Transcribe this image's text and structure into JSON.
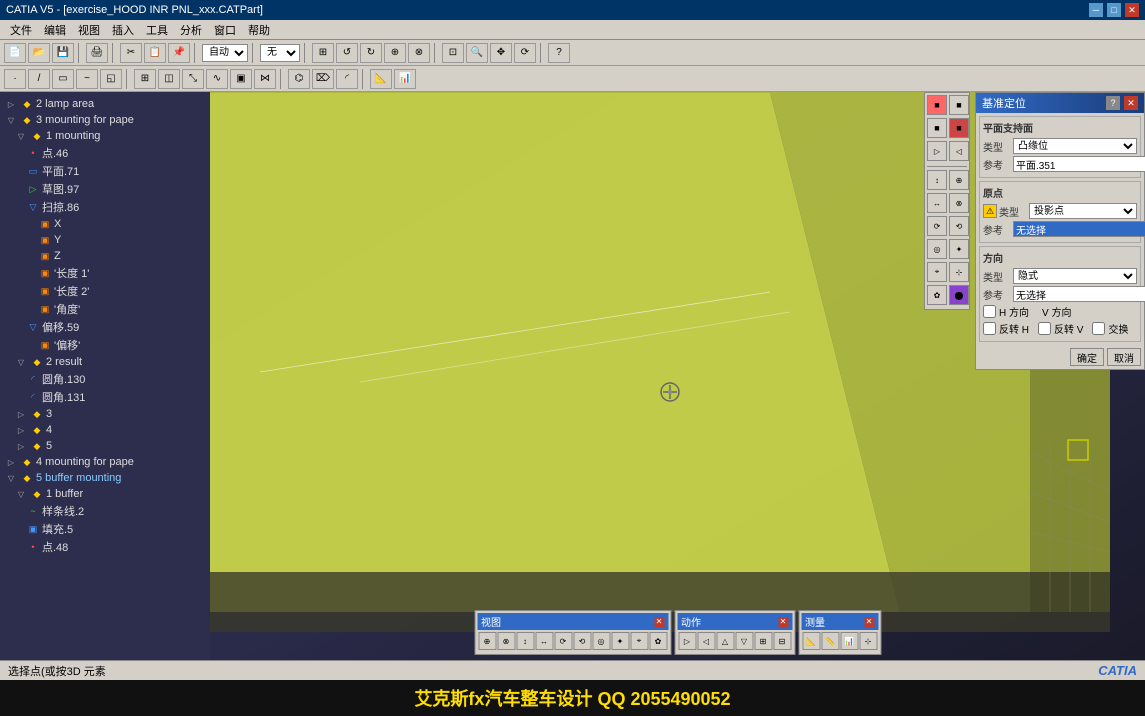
{
  "app": {
    "title": "CATIA V5 - [exercise_HOOD INR PNL_xxx.CATPart]",
    "version": "CATIA V5"
  },
  "menu": {
    "items": [
      "文件",
      "编辑",
      "视图",
      "插入",
      "工具",
      "分析",
      "窗口",
      "帮助"
    ]
  },
  "toolbar": {
    "dropdown1": "自动",
    "dropdown2": "无",
    "save_label": "保存",
    "undo_label": "撤消"
  },
  "tree": {
    "items": [
      {
        "id": "t1",
        "label": "2 lamp area",
        "level": 1,
        "icon": "branch",
        "type": "folder"
      },
      {
        "id": "t2",
        "label": "3 mounting for pape",
        "level": 1,
        "icon": "branch",
        "type": "folder"
      },
      {
        "id": "t3",
        "label": "1 mounting",
        "level": 2,
        "icon": "branch",
        "type": "folder"
      },
      {
        "id": "t4",
        "label": "点.46",
        "level": 3,
        "icon": "dot",
        "type": "point"
      },
      {
        "id": "t5",
        "label": "平面.71",
        "level": 3,
        "icon": "plane",
        "type": "plane"
      },
      {
        "id": "t6",
        "label": "草图.97",
        "level": 3,
        "icon": "sketch",
        "type": "sketch"
      },
      {
        "id": "t7",
        "label": "扫掠.86",
        "level": 3,
        "icon": "sweep",
        "type": "sweep"
      },
      {
        "id": "t8",
        "label": "X",
        "level": 4,
        "icon": "param",
        "type": "param"
      },
      {
        "id": "t9",
        "label": "Y",
        "level": 4,
        "icon": "param",
        "type": "param"
      },
      {
        "id": "t10",
        "label": "Z",
        "level": 4,
        "icon": "param",
        "type": "param"
      },
      {
        "id": "t11",
        "label": "'长度 1'",
        "level": 4,
        "icon": "param",
        "type": "param"
      },
      {
        "id": "t12",
        "label": "'长度 2'",
        "level": 4,
        "icon": "param",
        "type": "param"
      },
      {
        "id": "t13",
        "label": "'角度'",
        "level": 4,
        "icon": "param",
        "type": "param"
      },
      {
        "id": "t14",
        "label": "偏移.59",
        "level": 3,
        "icon": "offset",
        "type": "offset"
      },
      {
        "id": "t15",
        "label": "'偏移'",
        "level": 4,
        "icon": "param",
        "type": "param"
      },
      {
        "id": "t16",
        "label": "2 result",
        "level": 2,
        "icon": "branch",
        "type": "folder"
      },
      {
        "id": "t17",
        "label": "圆角.130",
        "level": 3,
        "icon": "fillet",
        "type": "fillet"
      },
      {
        "id": "t18",
        "label": "圆角.131",
        "level": 3,
        "icon": "fillet",
        "type": "fillet"
      },
      {
        "id": "t19",
        "label": "3",
        "level": 2,
        "icon": "branch",
        "type": "folder"
      },
      {
        "id": "t20",
        "label": "4",
        "level": 2,
        "icon": "branch",
        "type": "folder"
      },
      {
        "id": "t21",
        "label": "5",
        "level": 2,
        "icon": "branch",
        "type": "folder"
      },
      {
        "id": "t22",
        "label": "4 mounting for pape",
        "level": 1,
        "icon": "branch",
        "type": "folder"
      },
      {
        "id": "t23",
        "label": "5 buffer mounting",
        "level": 1,
        "icon": "branch",
        "type": "folder",
        "expanded": true
      },
      {
        "id": "t24",
        "label": "1 buffer",
        "level": 2,
        "icon": "branch",
        "type": "folder"
      },
      {
        "id": "t25",
        "label": "样条线.2",
        "level": 3,
        "icon": "spline",
        "type": "spline"
      },
      {
        "id": "t26",
        "label": "填充.5",
        "level": 3,
        "icon": "fill",
        "type": "fill"
      },
      {
        "id": "t27",
        "label": "点.48",
        "level": 3,
        "icon": "dot",
        "type": "point"
      }
    ]
  },
  "dialog": {
    "title": "基准定位",
    "surface_section": "平面支持面",
    "surface_type_label": "类型",
    "surface_type_value": "凸缘位",
    "surface_ref_label": "参考",
    "surface_ref_value": "平面.351",
    "origin_section": "原点",
    "origin_type_label": "类型",
    "origin_type_value": "投影点",
    "origin_ref_label": "参考",
    "origin_ref_value": "无选择",
    "direction_section": "方向",
    "dir_type_label": "类型",
    "dir_type_value": "隐式",
    "dir_ref_label": "参考",
    "dir_ref_value": "无选择",
    "h_direction": "H 方向",
    "v_direction": "V 方向",
    "reverse_h": "反转 H",
    "reverse_v": "反转 V",
    "exchange": "交换",
    "ok_label": "确定",
    "cancel_label": "取消"
  },
  "mini_panels": [
    {
      "id": "view",
      "title": "视图"
    },
    {
      "id": "action",
      "title": "动作"
    },
    {
      "id": "measure",
      "title": "测量"
    }
  ],
  "status_bar": {
    "text": "选择点(或按3D 元素"
  },
  "bottom": {
    "text": "艾克斯fx汽车整车设计 QQ 2055490052"
  }
}
